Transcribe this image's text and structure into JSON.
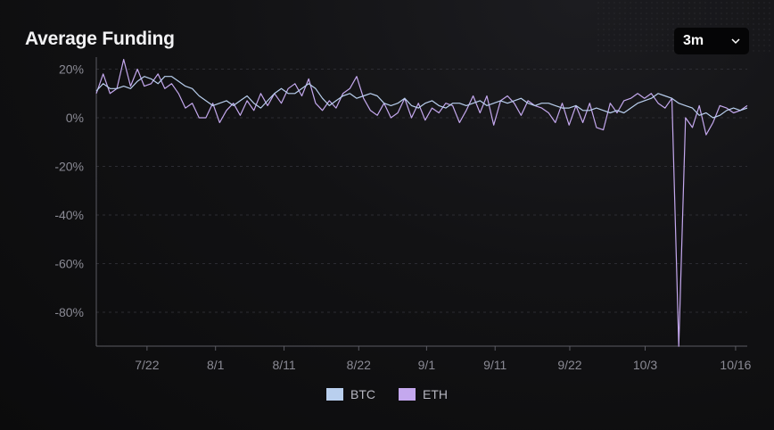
{
  "card": {
    "title": "Average Funding",
    "range_selector": {
      "value": "3m",
      "icon": "chevron-down-icon"
    }
  },
  "chart_data": {
    "type": "line",
    "title": "Average Funding",
    "xlabel": "",
    "ylabel": "",
    "ylim": [
      -94,
      24
    ],
    "grid": "horizontal-dashed",
    "legend_placement": "bottom-center",
    "y_ticks": [
      {
        "value": 20,
        "label": "20%"
      },
      {
        "value": 0,
        "label": "0%"
      },
      {
        "value": -20,
        "label": "-20%"
      },
      {
        "value": -40,
        "label": "-40%"
      },
      {
        "value": -60,
        "label": "-60%"
      },
      {
        "value": -80,
        "label": "-80%"
      }
    ],
    "x_ticks": [
      {
        "value": 7.4,
        "label": "7/22"
      },
      {
        "value": 17.4,
        "label": "8/1"
      },
      {
        "value": 27.4,
        "label": "8/11"
      },
      {
        "value": 38.3,
        "label": "8/22"
      },
      {
        "value": 48.2,
        "label": "9/1"
      },
      {
        "value": 58.2,
        "label": "9/11"
      },
      {
        "value": 69.1,
        "label": "9/22"
      },
      {
        "value": 80.1,
        "label": "10/3"
      },
      {
        "value": 93.3,
        "label": "10/16"
      }
    ],
    "x_range": [
      0,
      95
    ],
    "series": [
      {
        "name": "BTC",
        "color": "#b9cfee",
        "x": [
          0,
          1,
          2,
          3,
          4,
          5,
          6,
          7,
          8,
          9,
          10,
          11,
          12,
          13,
          14,
          15,
          16,
          17,
          18,
          19,
          20,
          21,
          22,
          23,
          24,
          25,
          26,
          27,
          28,
          29,
          30,
          31,
          32,
          33,
          34,
          35,
          36,
          37,
          38,
          39,
          40,
          41,
          42,
          43,
          44,
          45,
          46,
          47,
          48,
          49,
          50,
          51,
          52,
          53,
          54,
          55,
          56,
          57,
          58,
          59,
          60,
          61,
          62,
          63,
          64,
          65,
          66,
          67,
          68,
          69,
          70,
          71,
          72,
          73,
          74,
          75,
          76,
          77,
          78,
          79,
          80,
          81,
          82,
          83,
          84,
          85,
          86,
          87,
          88,
          89,
          90,
          91,
          92,
          93,
          94,
          95
        ],
        "values": [
          11,
          14,
          12,
          12,
          13,
          12,
          15,
          17,
          16,
          14,
          17,
          17,
          15,
          13,
          12,
          9,
          7,
          5,
          6,
          7,
          5,
          7,
          9,
          6,
          4,
          7,
          10,
          12,
          10,
          10,
          12,
          14,
          12,
          8,
          5,
          7,
          9,
          10,
          8,
          9,
          10,
          9,
          6,
          5,
          6,
          8,
          5,
          4,
          6,
          7,
          5,
          4,
          6,
          6,
          5,
          6,
          7,
          5,
          6,
          7,
          6,
          7,
          8,
          6,
          5,
          6,
          6,
          5,
          4,
          4,
          5,
          3,
          3,
          4,
          3,
          2,
          3,
          2,
          4,
          6,
          7,
          8,
          10,
          9,
          8,
          6,
          5,
          4,
          1,
          2,
          0,
          1,
          3,
          4,
          3,
          4
        ]
      },
      {
        "name": "ETH",
        "color": "#c4a8ee",
        "x": [
          0,
          1,
          2,
          3,
          4,
          5,
          6,
          7,
          8,
          9,
          10,
          11,
          12,
          13,
          14,
          15,
          16,
          17,
          18,
          19,
          20,
          21,
          22,
          23,
          24,
          25,
          26,
          27,
          28,
          29,
          30,
          31,
          32,
          33,
          34,
          35,
          36,
          37,
          38,
          39,
          40,
          41,
          42,
          43,
          44,
          45,
          46,
          47,
          48,
          49,
          50,
          51,
          52,
          53,
          54,
          55,
          56,
          57,
          58,
          59,
          60,
          61,
          62,
          63,
          64,
          65,
          66,
          67,
          68,
          69,
          70,
          71,
          72,
          73,
          74,
          75,
          76,
          77,
          78,
          79,
          80,
          81,
          82,
          83,
          84,
          85,
          86,
          87,
          88,
          89,
          90,
          91,
          92,
          93,
          94,
          95
        ],
        "values": [
          10,
          18,
          10,
          12,
          24,
          13,
          20,
          13,
          14,
          18,
          12,
          14,
          10,
          4,
          6,
          0,
          0,
          6,
          -2,
          3,
          6,
          1,
          7,
          3,
          10,
          5,
          10,
          6,
          12,
          14,
          9,
          16,
          6,
          3,
          7,
          4,
          10,
          12,
          17,
          8,
          3,
          1,
          6,
          0,
          2,
          8,
          0,
          6,
          -1,
          4,
          2,
          6,
          5,
          -2,
          3,
          9,
          2,
          9,
          -3,
          7,
          9,
          6,
          1,
          7,
          5,
          4,
          2,
          -2,
          6,
          -3,
          5,
          -2,
          6,
          -4,
          -5,
          6,
          2,
          7,
          8,
          10,
          8,
          10,
          6,
          4,
          8,
          -94,
          0,
          -4,
          5,
          -7,
          -2,
          5,
          4,
          2,
          3,
          5
        ]
      }
    ],
    "legend": [
      {
        "label": "BTC",
        "color": "#b9cfee"
      },
      {
        "label": "ETH",
        "color": "#c4a8ee"
      }
    ]
  }
}
